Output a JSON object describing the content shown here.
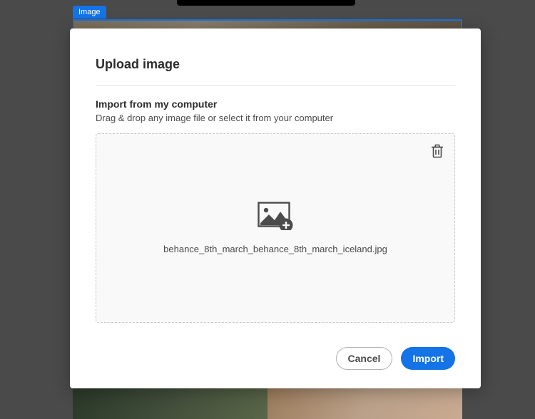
{
  "background": {
    "tag_label": "Image"
  },
  "modal": {
    "title": "Upload image",
    "section_title": "Import from my computer",
    "section_desc": "Drag & drop any image file or select it from your computer",
    "file_name": "behance_8th_march_behance_8th_march_iceland.jpg"
  },
  "buttons": {
    "cancel": "Cancel",
    "import": "Import"
  }
}
